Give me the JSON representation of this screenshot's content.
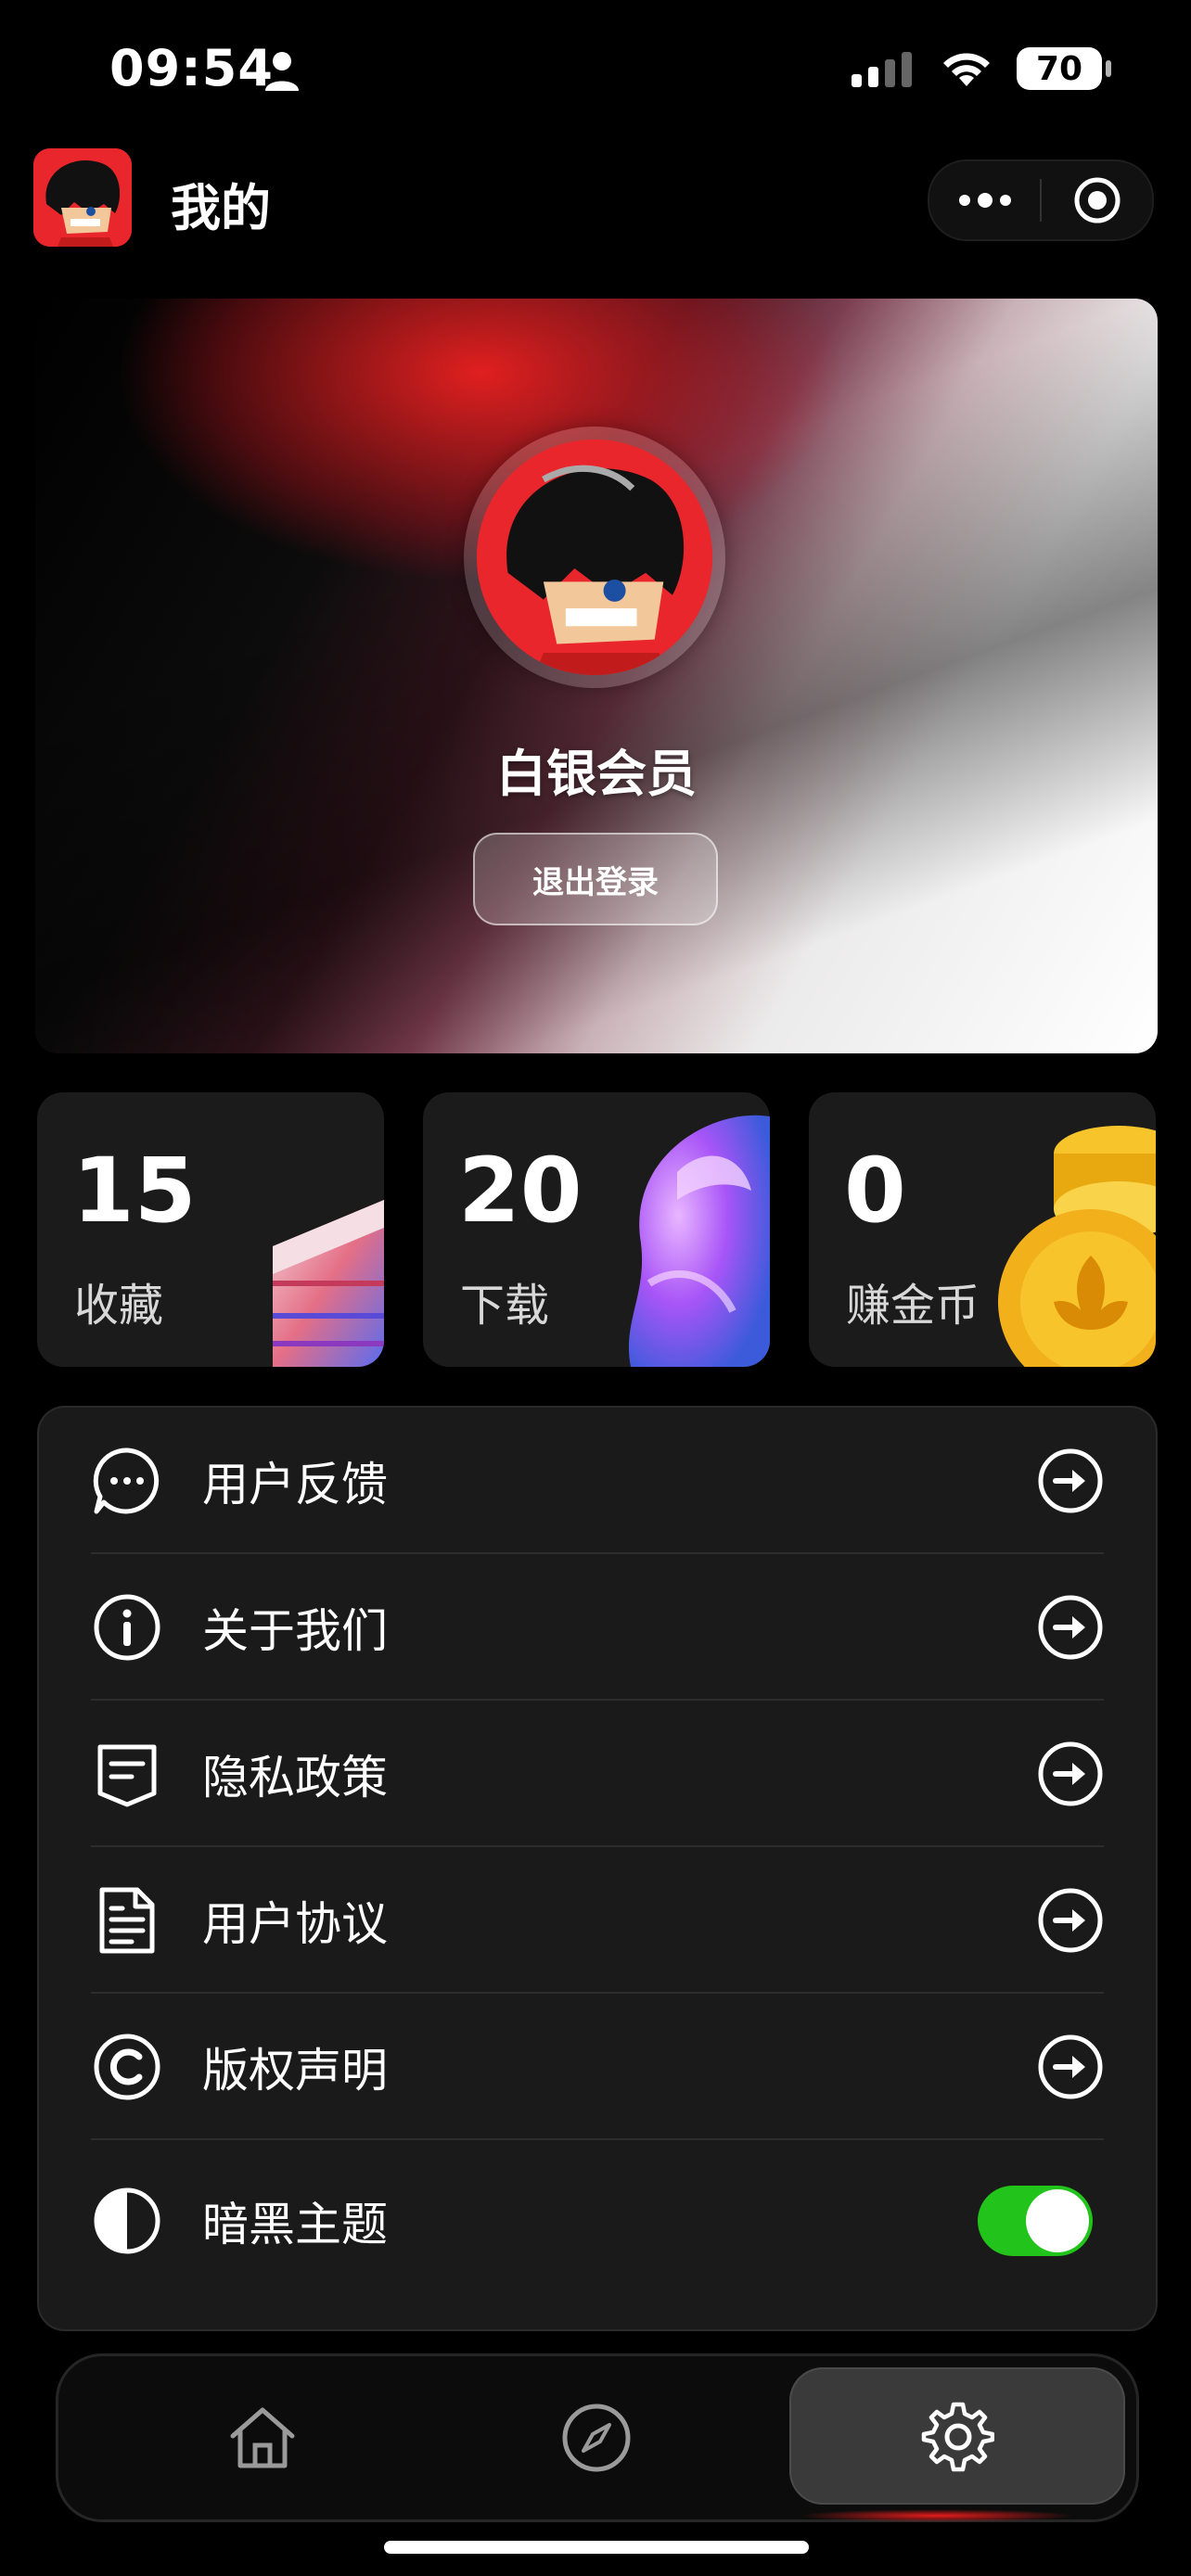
{
  "status_bar": {
    "time": "09:54",
    "battery": "70"
  },
  "header": {
    "title": "我的"
  },
  "profile": {
    "member_level": "白银会员",
    "logout_label": "退出登录"
  },
  "stats": [
    {
      "value": "15",
      "label": "收藏"
    },
    {
      "value": "20",
      "label": "下载"
    },
    {
      "value": "0",
      "label": "赚金币"
    }
  ],
  "menu": [
    {
      "label": "用户反馈",
      "icon": "chat-bubble-icon"
    },
    {
      "label": "关于我们",
      "icon": "info-icon"
    },
    {
      "label": "隐私政策",
      "icon": "policy-document-icon"
    },
    {
      "label": "用户协议",
      "icon": "agreement-document-icon"
    },
    {
      "label": "版权声明",
      "icon": "copyright-icon"
    },
    {
      "label": "暗黑主题",
      "icon": "contrast-icon"
    }
  ],
  "dark_theme_enabled": true,
  "tabs": [
    {
      "icon": "home-icon"
    },
    {
      "icon": "compass-icon"
    },
    {
      "icon": "gear-icon",
      "active": true
    }
  ],
  "colors": {
    "accent_red": "#e9262b",
    "toggle_on": "#22c31a",
    "card_bg": "#1b1b1b"
  }
}
